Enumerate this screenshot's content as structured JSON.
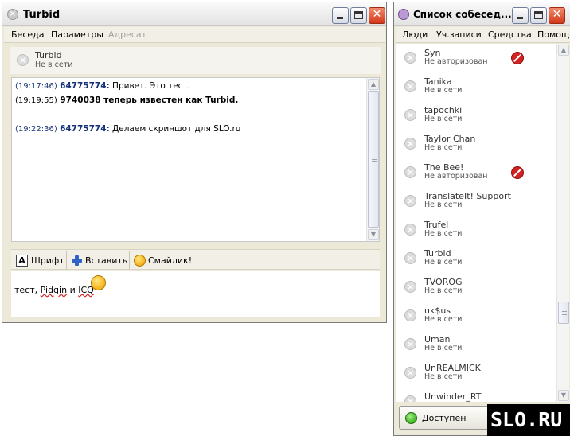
{
  "chat_window": {
    "title": "Turbid",
    "menu": [
      "Беседа",
      "Параметры",
      "Адресат"
    ],
    "contact": {
      "name": "Turbid",
      "status": "Не в сети"
    },
    "messages": [
      {
        "time": "(19:17:46)",
        "sender": "64775774:",
        "text": " Привет. Это тест."
      },
      {
        "time": "(19:19:55)",
        "system": "9740038 теперь известен как Turbid."
      },
      {
        "time": "(19:22:36)",
        "sender": "64775774:",
        "text": " Делаем скриншот для SLO.ru"
      }
    ],
    "toolbar": {
      "font": "Шрифт",
      "insert": "Вставить",
      "smiley": "Смайлик!"
    },
    "input": {
      "text_a": "тест, ",
      "text_pidgin": "Pidgin",
      "text_b": " и ",
      "text_icq": "ICQ"
    }
  },
  "buddy_window": {
    "title": "Список собесед...",
    "menu": [
      "Люди",
      "Уч.записи",
      "Средства",
      "Помощь"
    ],
    "buddies": [
      {
        "name": "Syn",
        "status": "Не авторизован",
        "blocked": true
      },
      {
        "name": "Tanika",
        "status": "Не в сети"
      },
      {
        "name": "tapochki",
        "status": "Не в сети"
      },
      {
        "name": "Taylor Chan",
        "status": "Не в сети"
      },
      {
        "name": "The Bee!",
        "status": "Не авторизован",
        "blocked": true
      },
      {
        "name": "TranslateIt! Support",
        "status": "Не в сети"
      },
      {
        "name": "Trufel",
        "status": "Не в сети"
      },
      {
        "name": "Turbid",
        "status": "Не в сети"
      },
      {
        "name": "TVOROG",
        "status": "Не в сети"
      },
      {
        "name": "uk$us",
        "status": "Не в сети"
      },
      {
        "name": "Uman",
        "status": "Не в сети"
      },
      {
        "name": "UnREALMICK",
        "status": "Не в сети"
      },
      {
        "name": "Unwinder_RT",
        "status": ""
      }
    ],
    "presence": "Доступен"
  },
  "watermark": "SLO.RU",
  "colors": {
    "accent_blue": "#16307a",
    "online_green": "#3cb521",
    "blocked_red": "#d22222"
  }
}
